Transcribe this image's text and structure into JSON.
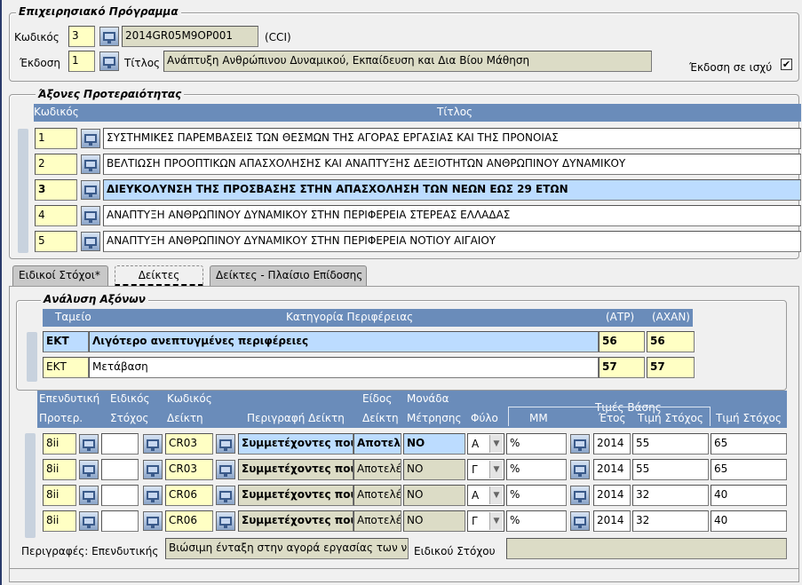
{
  "program": {
    "title": "Επιχειρησιακό Πρόγραμμα",
    "code_label": "Κωδικός",
    "code_value": "3",
    "cci_value": "2014GR05M9OP001",
    "cci_label": "(CCI)",
    "version_label": "Έκδοση",
    "version_value": "1",
    "title_label": "Τίτλος",
    "title_value": "Ανάπτυξη Ανθρώπινου Δυναμικού, Εκπαίδευση και Δια Βίου Μάθηση",
    "active_version_label": "Έκδοση σε ισχύ"
  },
  "axes": {
    "title": "Άξονες Προτεραιότητας",
    "col_code": "Κωδικός",
    "col_title": "Τίτλος",
    "rows": [
      {
        "code": "1",
        "title": "ΣΥΣΤΗΜΙΚΕΣ ΠΑΡΕΜΒΑΣΕΙΣ ΤΩΝ ΘΕΣΜΩΝ ΤΗΣ ΑΓΟΡΑΣ ΕΡΓΑΣΙΑΣ ΚΑΙ ΤΗΣ ΠΡΟΝΟΙΑΣ"
      },
      {
        "code": "2",
        "title": "ΒΕΛΤΙΩΣΗ ΠΡΟΟΠΤΙΚΩΝ ΑΠΑΣΧΟΛΗΣΗΣ ΚΑΙ ΑΝΑΠΤΥΞΗΣ ΔΕΞΙΟΤΗΤΩΝ ΑΝΘΡΩΠΙΝΟΥ ΔΥΝΑΜΙΚΟΥ"
      },
      {
        "code": "3",
        "title": "ΔΙΕΥΚΟΛΥΝΣΗ ΤΗΣ ΠΡΟΣΒΑΣΗΣ ΣΤΗΝ ΑΠΑΣΧΟΛΗΣΗ ΤΩΝ ΝΕΩΝ ΕΩΣ 29 ΕΤΩΝ"
      },
      {
        "code": "4",
        "title": "ΑΝΑΠΤΥΞΗ ΑΝΘΡΩΠΙΝΟΥ ΔΥΝΑΜΙΚΟΥ ΣΤΗΝ ΠΕΡΙΦΕΡΕΙΑ ΣΤΕΡΕΑΣ ΕΛΛΑΔΑΣ"
      },
      {
        "code": "5",
        "title": "ΑΝΑΠΤΥΞΗ ΑΝΘΡΩΠΙΝΟΥ ΔΥΝΑΜΙΚΟΥ ΣΤΗΝ ΠΕΡΙΦΕΡΕΙΑ ΝΟΤΙΟΥ ΑΙΓΑΙΟΥ"
      }
    ]
  },
  "tabs": [
    "Ειδικοί Στόχοι*",
    "Δείκτες",
    "Δείκτες - Πλαίσιο Επίδοσης"
  ],
  "analysis": {
    "title": "Ανάλυση Αξόνων",
    "col_fund": "Ταμείο",
    "col_category": "Κατηγορία Περιφέρειας",
    "col_atp": "(ΑΤΡ)",
    "col_axan": "(ΑΧΑΝ)",
    "rows": [
      {
        "fund": "ΕΚΤ",
        "category": "Λιγότερο ανεπτυγμένες περιφέρειες",
        "atp": "56",
        "axan": "56"
      },
      {
        "fund": "ΕΚΤ",
        "category": "Μετάβαση",
        "atp": "57",
        "axan": "57"
      }
    ]
  },
  "indicators": {
    "h_invest_1": "Επενδυτική",
    "h_invest_2": "Προτερ.",
    "h_spec_1": "Ειδικός",
    "h_spec_2": "Στόχος",
    "h_code_1": "Κωδικός",
    "h_code_2": "Δείκτη",
    "h_desc": "Περιγραφή Δείκτη",
    "h_type_1": "Είδος",
    "h_type_2": "Δείκτη",
    "h_unit_1": "Μονάδα",
    "h_unit_2": "Μέτρησης",
    "h_gender": "Φύλο",
    "h_mm": "ΜΜ",
    "h_base": "Τιμές Βάσης",
    "h_year": "Έτος",
    "h_target_val": "Τιμή Στόχος",
    "h_target": "Τιμή Στόχος",
    "rows": [
      {
        "invest": "8ii",
        "spec": "",
        "code": "CR03",
        "desc": "Συμμετέχοντες που",
        "type": "Αποτελ",
        "unit": "ΝΟ",
        "gender": "Α",
        "mm": "%",
        "year": "2014",
        "base": "55",
        "target": "65"
      },
      {
        "invest": "8ii",
        "spec": "",
        "code": "CR03",
        "desc": "Συμμετέχοντες που ο",
        "type": "Αποτελέ",
        "unit": "ΝΟ",
        "gender": "Γ",
        "mm": "%",
        "year": "2014",
        "base": "55",
        "target": "65"
      },
      {
        "invest": "8ii",
        "spec": "",
        "code": "CR06",
        "desc": "Συμμετέχοντες που κ",
        "type": "Αποτελέ",
        "unit": "ΝΟ",
        "gender": "Α",
        "mm": "%",
        "year": "2014",
        "base": "32",
        "target": "40"
      },
      {
        "invest": "8ii",
        "spec": "",
        "code": "CR06",
        "desc": "Συμμετέχοντες που κ",
        "type": "Αποτελέ",
        "unit": "ΝΟ",
        "gender": "Γ",
        "mm": "%",
        "year": "2014",
        "base": "32",
        "target": "40"
      }
    ],
    "footer_label": "Περιγραφές: Επενδυτικής",
    "footer_value": "Βιώσιμη ένταξη στην αγορά εργασίας των νέω",
    "footer_spec_label": "Ειδικού Στόχου",
    "footer_spec_value": ""
  }
}
